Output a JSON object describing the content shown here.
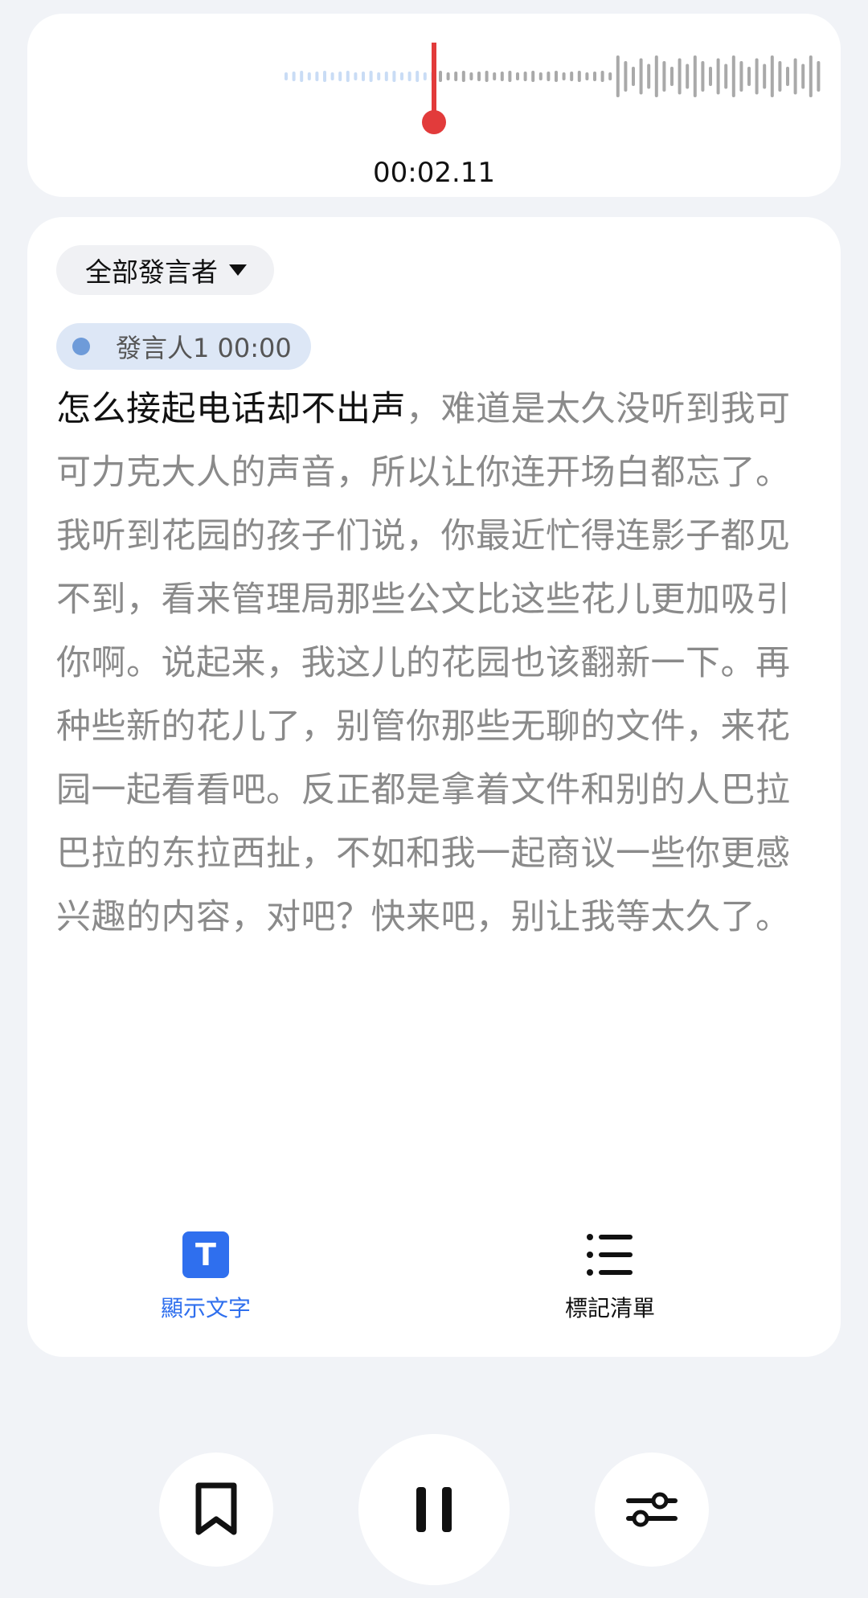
{
  "waveform": {
    "elapsed": "00:02.11",
    "playhead_color": "#e23b3b",
    "played_color": "#c9dcf5",
    "unplayed_color": "#a9a9a9"
  },
  "transcript": {
    "speaker_filter": "全部發言者",
    "speaker_chip": "發言人1 00:00",
    "spoken_text": "怎么接起电话却不出声",
    "remaining_text": "，难道是太久没听到我可可力克大人的声音，所以让你连开场白都忘了。我听到花园的孩子们说，你最近忙得连影子都见不到，看来管理局那些公文比这些花儿更加吸引你啊。说起来，我这儿的花园也该翻新一下。再种些新的花儿了，别管你那些无聊的文件，来花园一起看看吧。反正都是拿着文件和别的人巴拉巴拉的东拉西扯，不如和我一起商议一些你更感兴趣的内容，对吧？快来吧，别让我等太久了。"
  },
  "tabs": {
    "show_text_icon_letter": "T",
    "show_text_label": "顯示文字",
    "mark_list_label": "標記清單",
    "active_color": "#2f6fee"
  },
  "controls": {
    "bookmark_icon": "bookmark-icon",
    "pause_icon": "pause-icon",
    "adjust_icon": "sliders-icon"
  }
}
